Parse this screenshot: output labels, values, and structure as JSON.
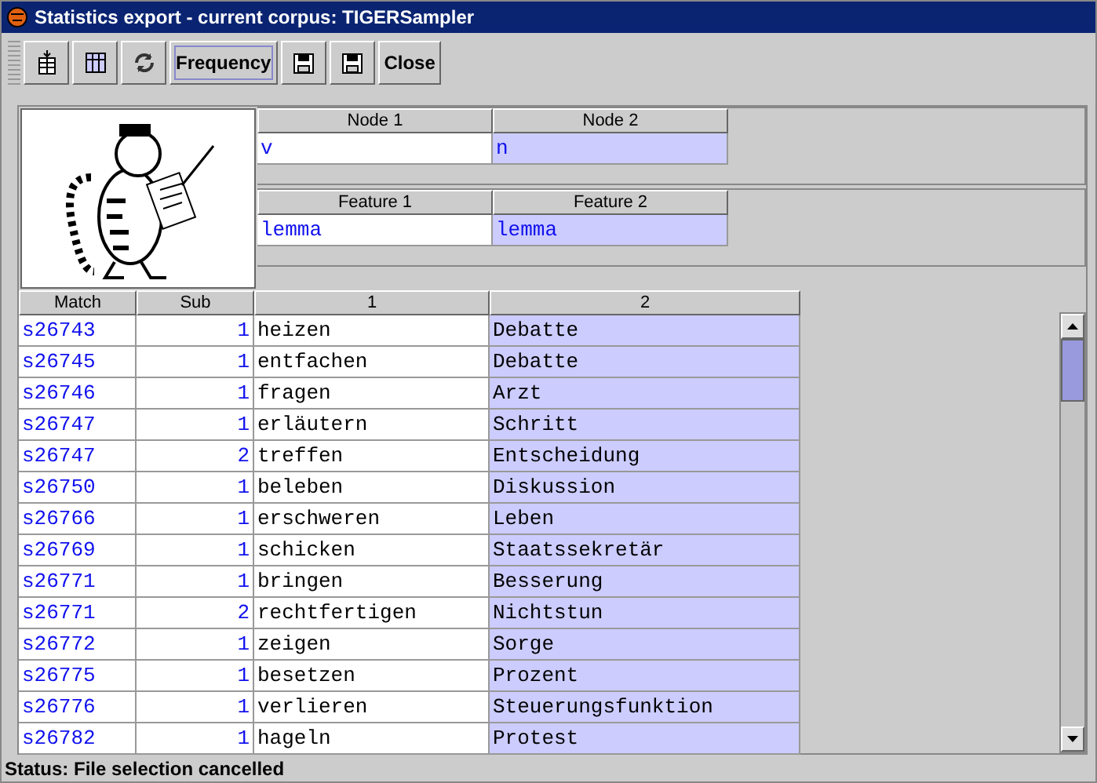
{
  "window": {
    "title": "Statistics export - current corpus: TIGERSampler"
  },
  "toolbar": [
    {
      "kind": "insert",
      "focused": false
    },
    {
      "kind": "columns",
      "focused": false
    },
    {
      "kind": "refresh",
      "focused": false
    },
    {
      "kind": "text",
      "label": "Frequency",
      "focused": true
    },
    {
      "kind": "save",
      "focused": false
    },
    {
      "kind": "save",
      "focused": false
    },
    {
      "kind": "text",
      "label": "Close",
      "focused": false
    }
  ],
  "nodes_table": {
    "columns": [
      {
        "label": "Node 1",
        "selected": false,
        "value": "v"
      },
      {
        "label": "Node 2",
        "selected": true,
        "value": "n"
      }
    ]
  },
  "features_table": {
    "columns": [
      {
        "label": "Feature 1",
        "selected": false,
        "value": "lemma"
      },
      {
        "label": "Feature 2",
        "selected": true,
        "value": "lemma"
      }
    ]
  },
  "results_table": {
    "columns": [
      {
        "label": "Match",
        "selected": false
      },
      {
        "label": "Sub",
        "selected": false
      },
      {
        "label": "1",
        "selected": false
      },
      {
        "label": "2",
        "selected": true
      }
    ],
    "rows": [
      [
        "s26743",
        "1",
        "heizen",
        "Debatte"
      ],
      [
        "s26745",
        "1",
        "entfachen",
        "Debatte"
      ],
      [
        "s26746",
        "1",
        "fragen",
        "Arzt"
      ],
      [
        "s26747",
        "1",
        "erläutern",
        "Schritt"
      ],
      [
        "s26747",
        "2",
        "treffen",
        "Entscheidung"
      ],
      [
        "s26750",
        "1",
        "beleben",
        "Diskussion"
      ],
      [
        "s26766",
        "1",
        "erschweren",
        "Leben"
      ],
      [
        "s26769",
        "1",
        "schicken",
        "Staatssekretär"
      ],
      [
        "s26771",
        "1",
        "bringen",
        "Besserung"
      ],
      [
        "s26771",
        "2",
        "rechtfertigen",
        "Nichtstun"
      ],
      [
        "s26772",
        "1",
        "zeigen",
        "Sorge"
      ],
      [
        "s26775",
        "1",
        "besetzen",
        "Prozent"
      ],
      [
        "s26776",
        "1",
        "verlieren",
        "Steuerungsfunktion"
      ],
      [
        "s26782",
        "1",
        "hageln",
        "Protest"
      ]
    ]
  },
  "status_bar": "Status: File selection cancelled"
}
